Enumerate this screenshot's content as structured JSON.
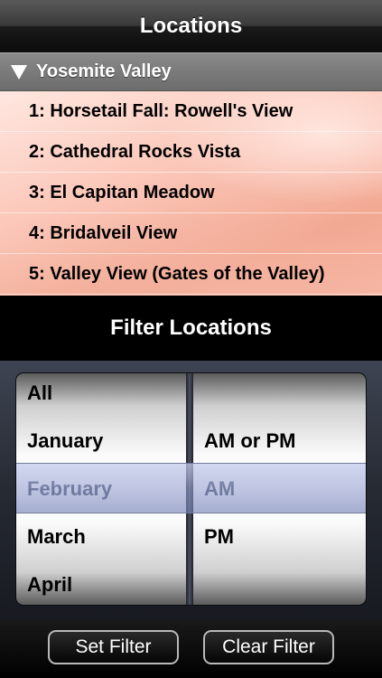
{
  "navbar": {
    "title": "Locations"
  },
  "section": {
    "title": "Yosemite Valley",
    "expanded_icon": "triangle-down-icon"
  },
  "locations": [
    "1: Horsetail Fall: Rowell's View",
    "2: Cathedral Rocks Vista",
    "3: El Capitan Meadow",
    "4: Bridalveil View",
    "5: Valley View (Gates of the Valley)"
  ],
  "filter": {
    "title": "Filter Locations"
  },
  "picker": {
    "months": [
      "All",
      "January",
      "February",
      "March",
      "April"
    ],
    "selected_month": "February",
    "times": [
      "",
      "AM or PM",
      "AM",
      "PM",
      ""
    ],
    "selected_time": "AM"
  },
  "toolbar": {
    "set_label": "Set Filter",
    "clear_label": "Clear Filter"
  },
  "colors": {
    "navbar": "#1a1a1a",
    "section": "#7a7a7a",
    "selection": "#9aa4d6"
  }
}
